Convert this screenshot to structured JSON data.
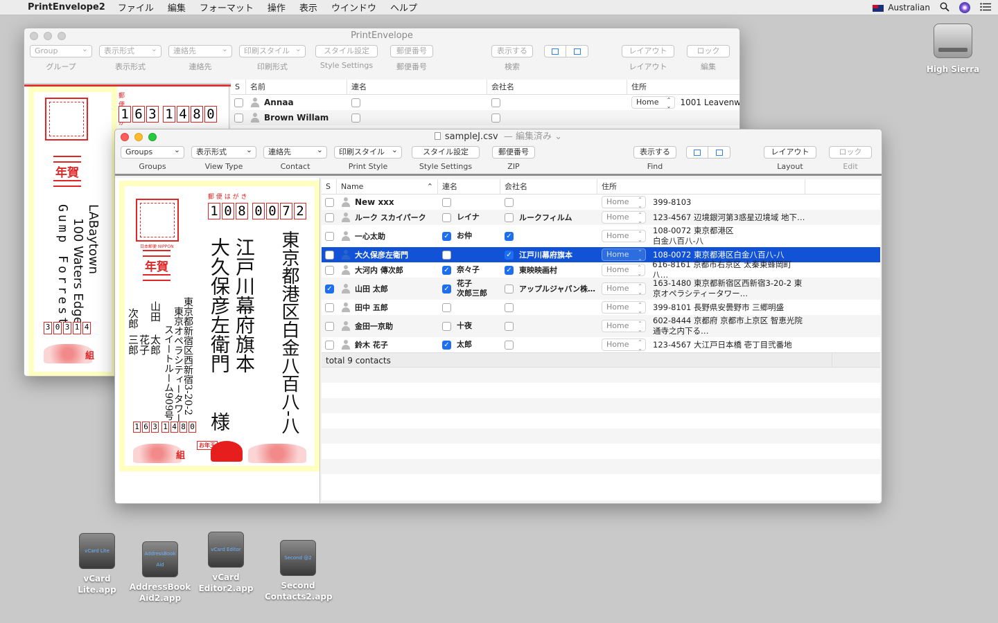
{
  "menubar": {
    "app_name": "PrintEnvelope2",
    "items": [
      "ファイル",
      "編集",
      "フォーマット",
      "操作",
      "表示",
      "ウインドウ",
      "ヘルプ"
    ],
    "input_source": "Australian"
  },
  "desktop": {
    "drive": "High Sierra",
    "apps": [
      {
        "name": "vCard Lite.app",
        "badge": "vCard Lite"
      },
      {
        "name": "AddressBook Aid2.app",
        "line1": "AddressBook",
        "line2": "Aid2.app",
        "badge": "AddressBook Aid"
      },
      {
        "name": "vCard Editor2.app",
        "badge": "vCard Editor"
      },
      {
        "name": "Second Contacts2.app",
        "line1": "Second",
        "line2": "Contacts2.app",
        "badge": "Second @2"
      }
    ]
  },
  "back_window": {
    "title": "PrintEnvelope",
    "toolbar": {
      "group": {
        "value": "Group",
        "label": "グループ"
      },
      "view": {
        "value": "表示形式",
        "label": "表示形式"
      },
      "contact": {
        "value": "連絡先",
        "label": "連絡先"
      },
      "print": {
        "value": "印刷スタイル",
        "label": "印刷形式"
      },
      "style": {
        "value": "スタイル設定",
        "label": "Style Settings"
      },
      "zip": {
        "value": "郵便番号",
        "label": "郵便番号"
      },
      "find": {
        "value": "表示する",
        "label": "検索"
      },
      "layout": {
        "value": "レイアウト",
        "label": "レイアウト"
      },
      "edit": {
        "value": "ロック",
        "label": "編集"
      }
    },
    "columns": [
      "S",
      "名前",
      "連名",
      "会社名",
      "住所"
    ],
    "rows": [
      {
        "name": "Annaa",
        "address_type": "Home",
        "address": "1001  Leavenw"
      },
      {
        "name": "Brown Willam",
        "address_type": "",
        "address": ""
      }
    ],
    "preview": {
      "zip": [
        "1",
        "6",
        "3",
        "1",
        "4",
        "8",
        "0"
      ],
      "postcard_label": "郵 便 は が き",
      "nenga": "年賀",
      "address_line1": "LABaytown",
      "address_line2": "100 Waters Edge",
      "name": "Gump Forrest",
      "sender_zip": [
        "3",
        "0",
        "3",
        "1",
        "4"
      ],
      "seal_text": "組"
    }
  },
  "front_window": {
    "title": "sampleJ.csv",
    "title_status": "— 編集済み ⌄",
    "toolbar": {
      "group": {
        "value": "Groups",
        "label": "Groups"
      },
      "view": {
        "value": "表示形式",
        "label": "View Type"
      },
      "contact": {
        "value": "連絡先",
        "label": "Contact"
      },
      "print": {
        "value": "印刷スタイル",
        "label": "Print Style"
      },
      "style": {
        "value": "スタイル設定",
        "label": "Style Settings"
      },
      "zip": {
        "value": "郵便番号",
        "label": "ZIP"
      },
      "find": {
        "value": "表示する",
        "label": "Find"
      },
      "layout": {
        "value": "レイアウト",
        "label": "Layout"
      },
      "edit": {
        "value": "ロック",
        "label": "Edit"
      }
    },
    "columns": [
      "S",
      "Name",
      "連名",
      "会社名",
      "住所"
    ],
    "rows": [
      {
        "s": false,
        "name": "New xxx",
        "name_bold": true,
        "joint_check": false,
        "joint": "",
        "company_check": false,
        "company": "",
        "address_type": "Home",
        "address": "399-8103",
        "tall": false
      },
      {
        "s": false,
        "name": "ルーク スカイパーク",
        "joint_check": false,
        "joint": "レイナ",
        "company_check": false,
        "company": "ルークフィルム",
        "address_type": "Home",
        "address": "123-4567 辺境銀河第3惑星辺境域 地下…",
        "tall": false
      },
      {
        "s": false,
        "name": "一心太助",
        "joint_check": true,
        "joint": "お仲",
        "company_check": true,
        "company": "",
        "address_type": "Home",
        "address": "108-0072 東京都港区\n白金八百八-八",
        "tall": true
      },
      {
        "s": false,
        "name": "大久保彦左衛門",
        "joint_check": false,
        "joint": "",
        "company_check": true,
        "company": "江戸川幕府旗本",
        "address_type": "Home",
        "address": "108-0072 東京都港区白金八百八-八",
        "tall": false,
        "selected": true
      },
      {
        "s": false,
        "name": "大河内 傳次郎",
        "joint_check": true,
        "joint": "奈々子",
        "company_check": true,
        "company": "東映映画村",
        "address_type": "Home",
        "address": "616-8161 京都市右京区 太秦東蜂岡町八…",
        "tall": false
      },
      {
        "s": true,
        "name": "山田 太郎",
        "joint_check": true,
        "joint": "花子\n次郎三郎",
        "company_check": false,
        "company": "アップルジャパン株…",
        "address_type": "Home",
        "address": "163-1480 東京都新宿区西新宿3-20-2 東\n京オペラシティータワー…",
        "tall": true
      },
      {
        "s": false,
        "name": "田中 五郎",
        "joint_check": false,
        "joint": "",
        "company_check": false,
        "company": "",
        "address_type": "Home",
        "address": "399-8101 長野県安曇野市 三郷明盛",
        "tall": false
      },
      {
        "s": false,
        "name": "金田一京助",
        "joint_check": false,
        "joint": "十夜",
        "company_check": false,
        "company": "",
        "address_type": "Home",
        "address": "602-8444 京都府 京都市上京区 智恵光院\n通寺之内下る…",
        "tall": true
      },
      {
        "s": false,
        "name": "鈴木 花子",
        "joint_check": true,
        "joint": "太郎",
        "company_check": false,
        "company": "",
        "address_type": "Home",
        "address": "123-4567 大江戸日本橋 壱丁目弐番地",
        "tall": false
      }
    ],
    "footer": "total 9 contacts",
    "preview": {
      "postcard_label": "郵 便 は が き",
      "zip": [
        "1",
        "0",
        "8",
        "0",
        "0",
        "7",
        "2"
      ],
      "address_col1": "東京都港区白金八百八-八",
      "company_col": "江戸川幕府旗本",
      "name_col": "大久保彦左衛門",
      "honorific": "様",
      "sender_addr1": "東京都新宿区西新宿3-20-2",
      "sender_addr2": "東京オペラシティータワー",
      "sender_addr3": "スイートルーム909号",
      "sender_name1": "山田",
      "sender_name2": "太郎",
      "sender_name3": "花子",
      "sender_name4": "次郎",
      "sender_name5": "三郎",
      "sender_zip": [
        "1",
        "6",
        "3",
        "1",
        "4",
        "8",
        "0"
      ],
      "nenga": "年賀",
      "seal_text": "組",
      "otoshidama": "お年玉"
    }
  }
}
